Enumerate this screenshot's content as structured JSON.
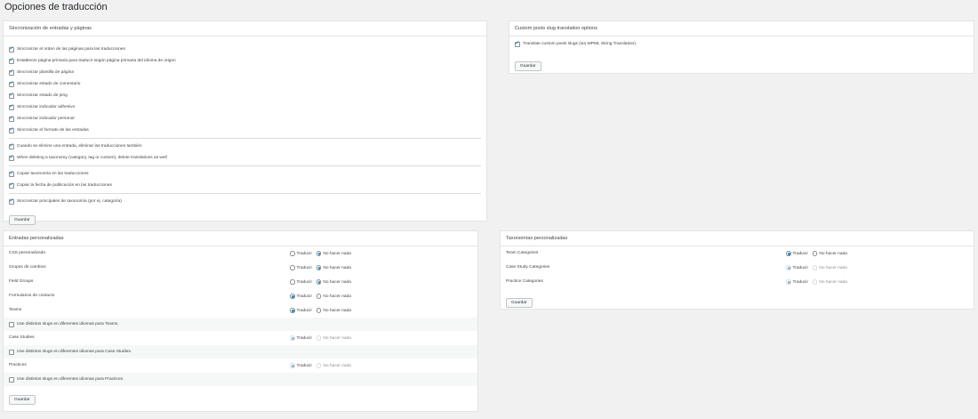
{
  "page_title": "Opciones de traducción",
  "sync": {
    "title": "Sincronización de entradas y páginas",
    "group1": [
      {
        "label": "Sincronizar el orden de las páginas para las traducciones",
        "checked": true
      },
      {
        "label": "Establecer página primaria para traducir según página primaria del idioma de origen",
        "checked": true
      },
      {
        "label": "Sincronizar plantilla de página",
        "checked": true
      },
      {
        "label": "Sincronizar estado de comentario",
        "checked": true
      },
      {
        "label": "Sincronizar estado de ping",
        "checked": true
      },
      {
        "label": "Sincronizar indicador adhesivo",
        "checked": true
      },
      {
        "label": "Sincronizar indicador personal",
        "checked": true
      },
      {
        "label": "Sincronizar el formato de las entradas",
        "checked": true
      }
    ],
    "group2": [
      {
        "label": "Cuando se elimine una entrada, eliminar las traducciones también",
        "checked": true
      },
      {
        "label": "When deleting a taxonomy (category, tag or custom), delete translations as well",
        "checked": true
      }
    ],
    "group3": [
      {
        "label": "Copiar taxonomía en las traducciones",
        "checked": true
      },
      {
        "label": "Copiar la fecha de publicación en las traducciones",
        "checked": true
      }
    ],
    "group4": [
      {
        "label": "Sincronizar principales de taxonomía (por ej. categoría)",
        "checked": true
      }
    ],
    "save": "Guardar"
  },
  "slug": {
    "title": "Custom posts slug translation options",
    "option": {
      "label": "Translate custom posts slugs (via WPML String Translation).",
      "checked": true
    },
    "save": "Guardar"
  },
  "cpt": {
    "title": "Entradas personalizadas",
    "translate_label": "Traducir",
    "nothing_label": "No hacer nada",
    "rows": [
      {
        "label": "CSS personalizado",
        "selected": "nothing",
        "disabled": false
      },
      {
        "label": "Grupos de cambios",
        "selected": "nothing",
        "disabled": false
      },
      {
        "label": "Field Groups",
        "selected": "nothing",
        "disabled": false
      },
      {
        "label": "Formularios de contacto",
        "selected": "translate",
        "disabled": false
      },
      {
        "label": "Teams",
        "selected": "translate",
        "disabled": false,
        "slug_note": "Use distintos slugs en diferentes idiomas para Teams."
      },
      {
        "label": "Case Studies",
        "selected": "translate",
        "disabled": true,
        "slug_note": "Use distintos slugs en diferentes idiomas para Case Studies."
      },
      {
        "label": "Practices",
        "selected": "translate",
        "disabled": true,
        "slug_note": "Use distintos slugs en diferentes idiomas para Practices."
      }
    ],
    "save": "Guardar"
  },
  "tax": {
    "title": "Taxonomías personalizadas",
    "translate_label": "Traducir",
    "nothing_label": "No hacer nada",
    "rows": [
      {
        "label": "Team Categories",
        "selected": "translate",
        "disabled": false
      },
      {
        "label": "Case Study Categories",
        "selected": "translate",
        "disabled": true
      },
      {
        "label": "Practice Categories",
        "selected": "translate",
        "disabled": true
      }
    ],
    "save": "Guardar"
  }
}
